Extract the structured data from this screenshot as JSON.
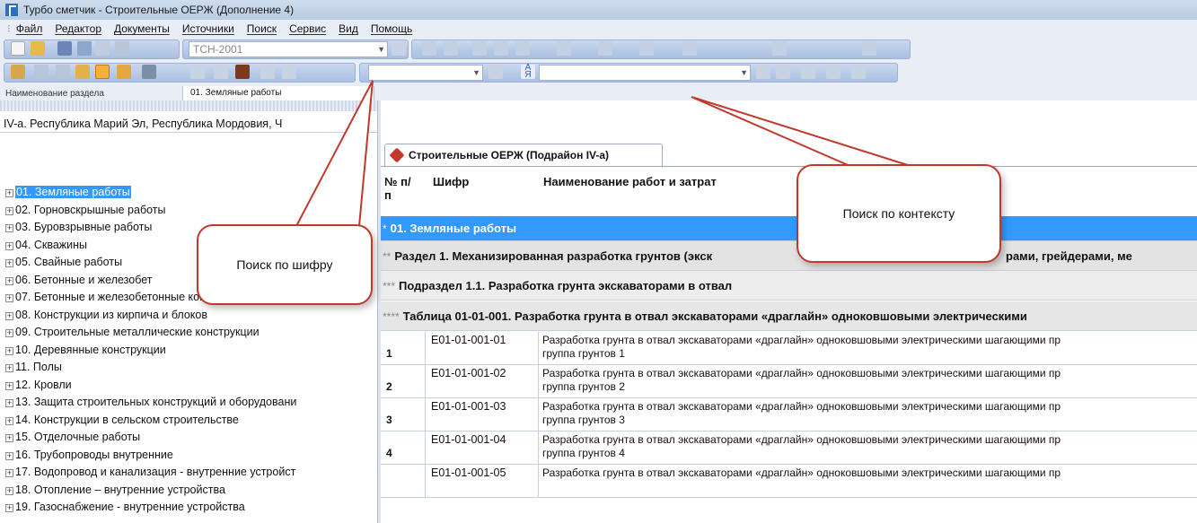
{
  "window": {
    "title": "Турбо сметчик - Строительные ОЕРЖ (Дополнение 4)"
  },
  "menu": [
    "Файл",
    "Редактор",
    "Документы",
    "Источники",
    "Поиск",
    "Сервис",
    "Вид",
    "Помощь"
  ],
  "toolbar": {
    "norm_base": "ТСН-2001"
  },
  "section_bar": {
    "label": "Наименование раздела",
    "value": "01. Земляные работы"
  },
  "left_panel": {
    "region": "IV-а. Республика Марий Эл, Республика Мордовия, Ч",
    "tree": [
      "01. Земляные работы",
      "02. Горновскрышные работы",
      "03. Буровзрывные работы",
      "04. Скважины",
      "05. Свайные работы",
      "06. Бетонные и железобет",
      "07. Бетонные и железобетонные конструкции сборн",
      "08. Конструкции из кирпича и блоков",
      "09. Строительные металлические конструкции",
      "10. Деревянные конструкции",
      "11. Полы",
      "12. Кровли",
      "13. Защита строительных конструкций и оборудовани",
      "14. Конструкции в сельском строительстве",
      "15. Отделочные работы",
      "16. Трубопроводы внутренние",
      "17. Водопровод и канализация - внутренние устройст",
      "18. Отопление – внутренние устройства",
      "19. Газоснабжение - внутренние устройства"
    ]
  },
  "tab": {
    "label": "Строительные ОЕРЖ (Подрайон IV-а)"
  },
  "grid": {
    "headers": {
      "num": "№ п/п",
      "code": "Шифр",
      "name": "Наименование работ и затрат"
    },
    "group": {
      "stars": "*",
      "text": "01. Земляные работы"
    },
    "sections": [
      {
        "stars": "**",
        "text": "Раздел 1. Механизированная разработка грунтов (экск",
        "tail": "рами, грейдерами, ме"
      },
      {
        "stars": "***",
        "text": "Подраздел 1.1. Разработка грунта экскаваторами в отвал"
      },
      {
        "stars": "****",
        "text": "Таблица 01-01-001. Разработка грунта в отвал экскаваторами «драглайн» одноковшовыми электрическими"
      }
    ],
    "rows": [
      {
        "num": "1",
        "code": "Е01-01-001-01",
        "name": "Разработка грунта в отвал экскаваторами «драглайн» одноковшовыми электрическими шагающими пр",
        "group": "группа грунтов 1"
      },
      {
        "num": "2",
        "code": "Е01-01-001-02",
        "name": "Разработка грунта в отвал экскаваторами «драглайн» одноковшовыми электрическими шагающими пр",
        "group": "группа грунтов 2"
      },
      {
        "num": "3",
        "code": "Е01-01-001-03",
        "name": "Разработка грунта в отвал экскаваторами «драглайн» одноковшовыми электрическими шагающими пр",
        "group": "группа грунтов 3"
      },
      {
        "num": "4",
        "code": "Е01-01-001-04",
        "name": "Разработка грунта в отвал экскаваторами «драглайн» одноковшовыми электрическими шагающими пр",
        "group": "группа грунтов 4"
      },
      {
        "num": "",
        "code": "Е01-01-001-05",
        "name": "Разработка грунта в отвал экскаваторами «драглайн» одноковшовыми электрическими шагающими пр",
        "group": ""
      }
    ]
  },
  "callouts": {
    "code_search": "Поиск по шифру",
    "context_search": "Поиск по контексту"
  },
  "colors": {
    "selection": "#3399ff",
    "callout_border": "#c0392b",
    "toolbar": "#e9eef6"
  }
}
